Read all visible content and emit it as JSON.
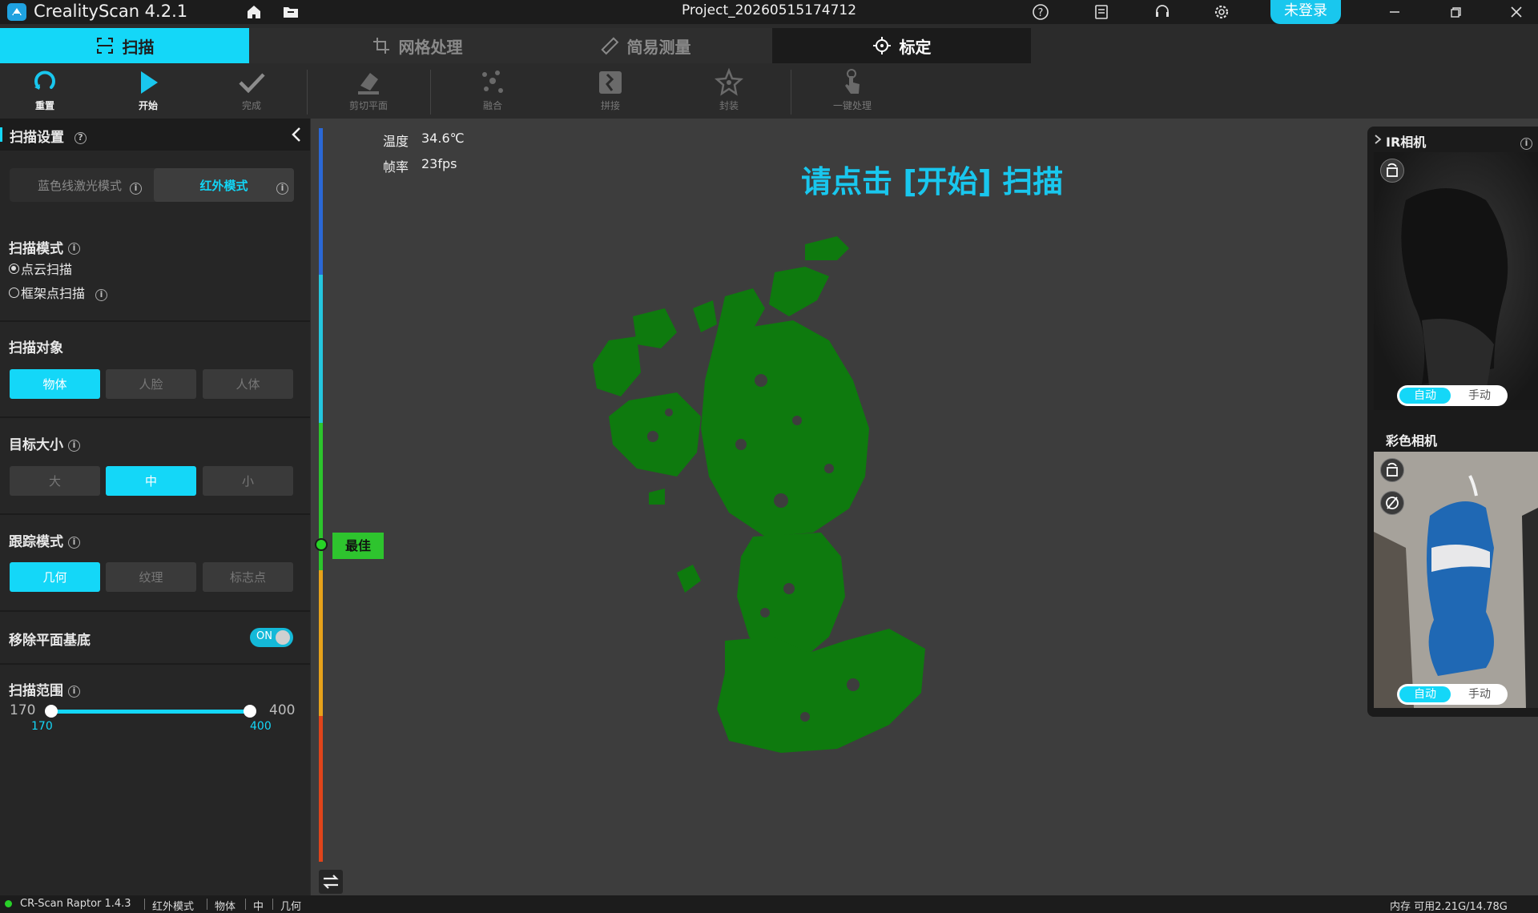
{
  "titlebar": {
    "app_title": "CrealityScan 4.2.1",
    "project_title": "Project_20260515174712",
    "login_label": "未登录"
  },
  "module_tabs": [
    {
      "label": "扫描",
      "state": "active"
    },
    {
      "label": "网格处理",
      "state": "inactive"
    },
    {
      "label": "简易测量",
      "state": "inactive"
    },
    {
      "label": "标定",
      "state": "dark"
    }
  ],
  "toolbar": {
    "reset": "重置",
    "start": "开始",
    "finish": "完成",
    "cut_plane": "剪切平面",
    "fuse": "融合",
    "stitch": "拼接",
    "encapsulate": "封装",
    "one_click": "一键处理"
  },
  "left_panel": {
    "title": "扫描设置",
    "scan_light": {
      "blue_laser": "蓝色线激光模式",
      "infrared": "红外模式",
      "selected": "红外模式"
    },
    "scan_mode": {
      "label": "扫描模式",
      "options": [
        "点云扫描",
        "框架点扫描"
      ],
      "selected": "点云扫描"
    },
    "scan_object": {
      "label": "扫描对象",
      "options": [
        "物体",
        "人脸",
        "人体"
      ],
      "selected": "物体"
    },
    "target_size": {
      "label": "目标大小",
      "options": [
        "大",
        "中",
        "小"
      ],
      "selected": "中"
    },
    "tracking_mode": {
      "label": "跟踪模式",
      "options": [
        "几何",
        "纹理",
        "标志点"
      ],
      "selected": "几何"
    },
    "remove_plane": {
      "label": "移除平面基底",
      "toggle_text": "ON",
      "enabled": true
    },
    "scan_range": {
      "label": "扫描范围",
      "min": "170",
      "max": "400",
      "low_value": "170",
      "high_value": "400"
    }
  },
  "viewport": {
    "temperature_label": "温度",
    "temperature_value": "34.6℃",
    "fps_label": "帧率",
    "fps_value": "23fps",
    "prompt": "请点击 [开始] 扫描",
    "distance_indicator": "最佳"
  },
  "right_panel": {
    "ir_camera": {
      "title": "IR相机",
      "auto": "自动",
      "manual": "手动"
    },
    "color_camera": {
      "title": "彩色相机",
      "auto": "自动",
      "manual": "手动"
    }
  },
  "statusbar": {
    "device": "CR-Scan Raptor 1.4.3",
    "mode": "红外模式",
    "object": "物体",
    "size": "中",
    "tracking": "几何",
    "memory": "内存 可用2.21G/14.78G"
  },
  "colors": {
    "accent": "#14d7f8",
    "point_cloud": "#0e7a0e",
    "best_indicator": "#2ec42e"
  }
}
